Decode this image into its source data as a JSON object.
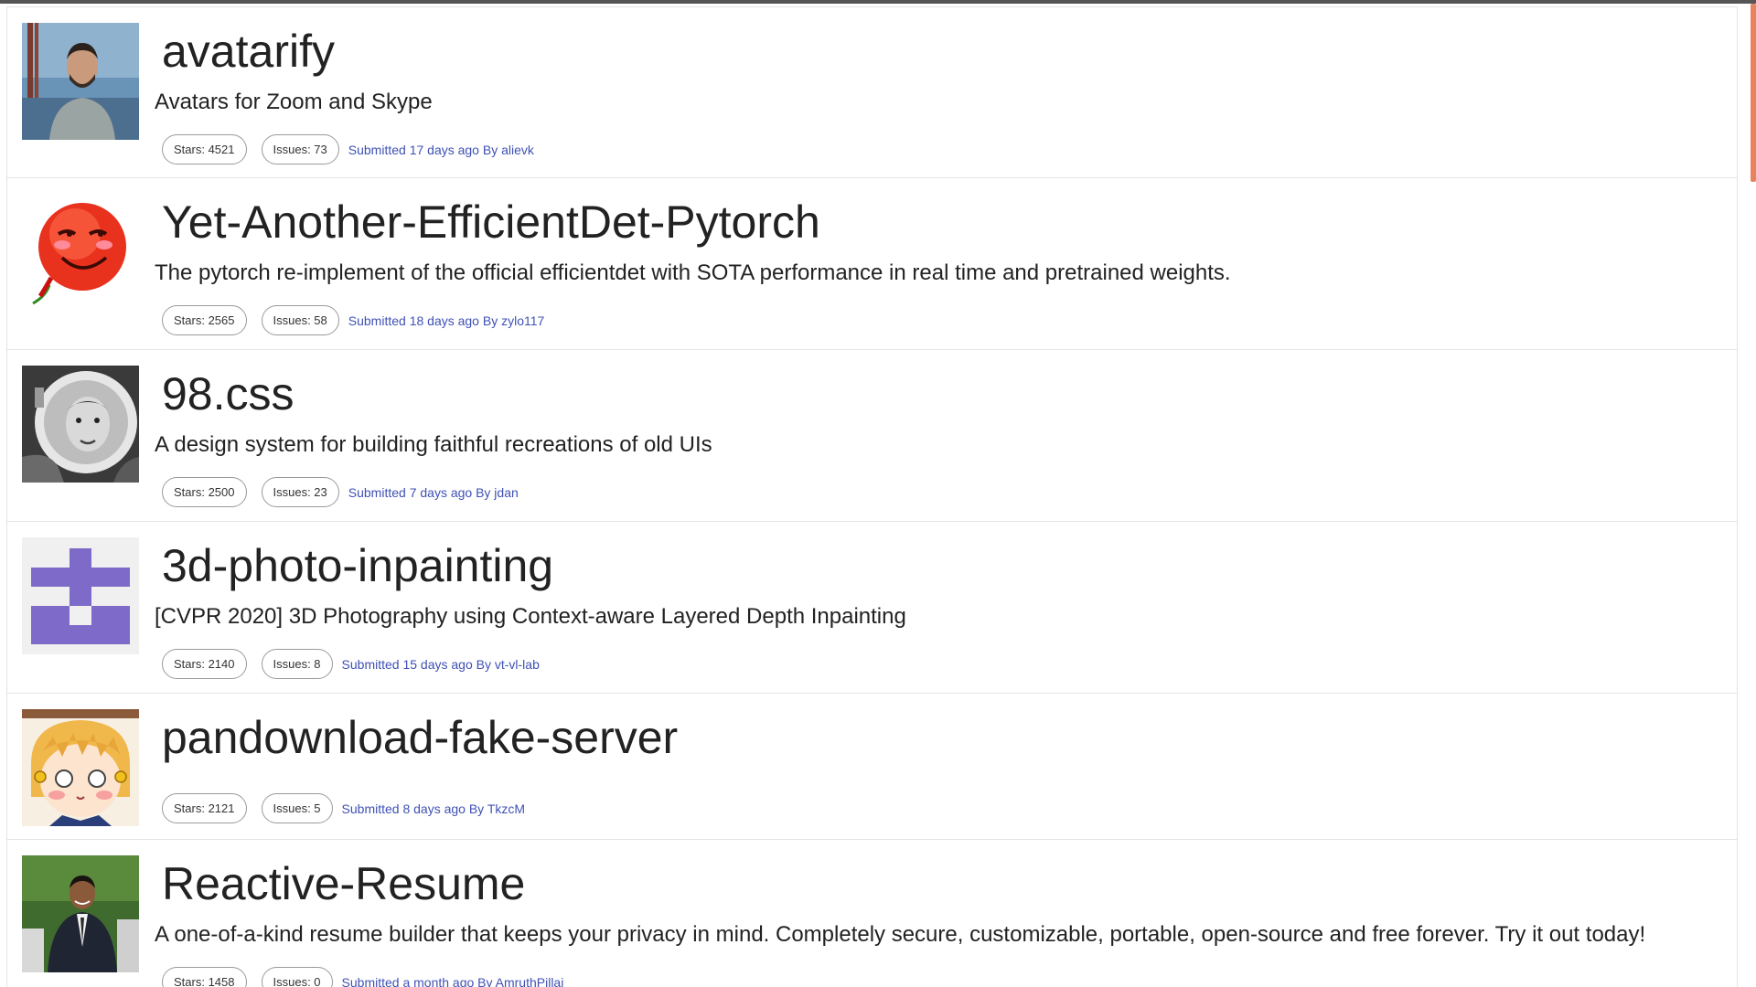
{
  "repos": [
    {
      "title": "avatarify",
      "description": "Avatars for Zoom and Skype",
      "stars": "Stars: 4521",
      "issues": "Issues: 73",
      "submitted": "Submitted 17 days ago By alievk",
      "avatar": "photo-man-bridge"
    },
    {
      "title": "Yet-Another-EfficientDet-Pytorch",
      "description": "The pytorch re-implement of the official efficientdet with SOTA performance in real time and pretrained weights.",
      "stars": "Stars: 2565",
      "issues": "Issues: 58",
      "submitted": "Submitted 18 days ago By zylo117",
      "avatar": "red-face-chili"
    },
    {
      "title": "98.css",
      "description": "A design system for building faithful recreations of old UIs",
      "stars": "Stars: 2500",
      "issues": "Issues: 23",
      "submitted": "Submitted 7 days ago By jdan",
      "avatar": "astronaut-bw"
    },
    {
      "title": "3d-photo-inpainting",
      "description": "[CVPR 2020] 3D Photography using Context-aware Layered Depth Inpainting",
      "stars": "Stars: 2140",
      "issues": "Issues: 8",
      "submitted": "Submitted 15 days ago By vt-vl-lab",
      "avatar": "purple-identicon"
    },
    {
      "title": "pandownload-fake-server",
      "description": "",
      "stars": "Stars: 2121",
      "issues": "Issues: 5",
      "submitted": "Submitted 8 days ago By TkzcM",
      "avatar": "anime-girl"
    },
    {
      "title": "Reactive-Resume",
      "description": "A one-of-a-kind resume builder that keeps your privacy in mind. Completely secure, customizable, portable, open-source and free forever. Try it out today!",
      "stars": "Stars: 1458",
      "issues": "Issues: 0",
      "submitted": "Submitted a month ago By AmruthPillai",
      "avatar": "photo-man-suit"
    }
  ],
  "colors": {
    "link": "#3f51b5",
    "pill_border": "#9a9a9a",
    "identicon": "#7e6bc9",
    "scroll_thumb": "#e8835f"
  }
}
